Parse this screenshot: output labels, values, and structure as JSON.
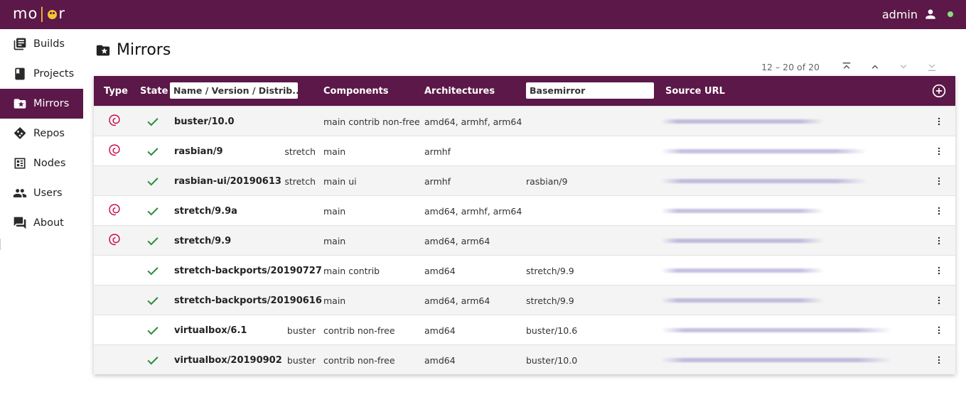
{
  "app": {
    "logo_left": "mo",
    "logo_right": "r",
    "user": "admin"
  },
  "sidebar": {
    "items": [
      {
        "label": "Builds",
        "icon": "builds-icon"
      },
      {
        "label": "Projects",
        "icon": "projects-icon"
      },
      {
        "label": "Mirrors",
        "icon": "mirrors-icon",
        "active": true
      },
      {
        "label": "Repos",
        "icon": "repos-icon"
      },
      {
        "label": "Nodes",
        "icon": "nodes-icon"
      },
      {
        "label": "Users",
        "icon": "users-icon"
      },
      {
        "label": "About",
        "icon": "about-icon"
      }
    ]
  },
  "page": {
    "title": "Mirrors"
  },
  "pager": {
    "range": "12 – 20 of 20"
  },
  "table": {
    "headers": {
      "type": "Type",
      "state": "State",
      "name_filter": "Name / Version / Distrib...",
      "components": "Components",
      "architectures": "Architectures",
      "basemirror_filter": "Basemirror",
      "source_url": "Source URL"
    },
    "rows": [
      {
        "debian": true,
        "name": "buster/10.0",
        "dist": "",
        "components": "main contrib non-free",
        "arch": "amd64, armhf, arm64",
        "basemirror": ""
      },
      {
        "debian": true,
        "name": "rasbian/9",
        "dist": "stretch",
        "components": "main",
        "arch": "armhf",
        "basemirror": ""
      },
      {
        "debian": false,
        "name": "rasbian-ui/20190613",
        "dist": "stretch",
        "components": "main ui",
        "arch": "armhf",
        "basemirror": "rasbian/9"
      },
      {
        "debian": true,
        "name": "stretch/9.9a",
        "dist": "",
        "components": "main",
        "arch": "amd64, armhf, arm64",
        "basemirror": ""
      },
      {
        "debian": true,
        "name": "stretch/9.9",
        "dist": "",
        "components": "main",
        "arch": "amd64, arm64",
        "basemirror": ""
      },
      {
        "debian": false,
        "name": "stretch-backports/20190727",
        "dist": "",
        "components": "main contrib",
        "arch": "amd64",
        "basemirror": "stretch/9.9"
      },
      {
        "debian": false,
        "name": "stretch-backports/20190616",
        "dist": "",
        "components": "main",
        "arch": "amd64, arm64",
        "basemirror": "stretch/9.9"
      },
      {
        "debian": false,
        "name": "virtualbox/6.1",
        "dist": "buster",
        "components": "contrib non-free",
        "arch": "amd64",
        "basemirror": "buster/10.6"
      },
      {
        "debian": false,
        "name": "virtualbox/20190902",
        "dist": "buster",
        "components": "contrib non-free",
        "arch": "amd64",
        "basemirror": "buster/10.0"
      }
    ]
  },
  "colors": {
    "brand": "#5b1848",
    "success": "#2e8b3a",
    "debian": "#c70a4e",
    "online": "#86e07e"
  }
}
